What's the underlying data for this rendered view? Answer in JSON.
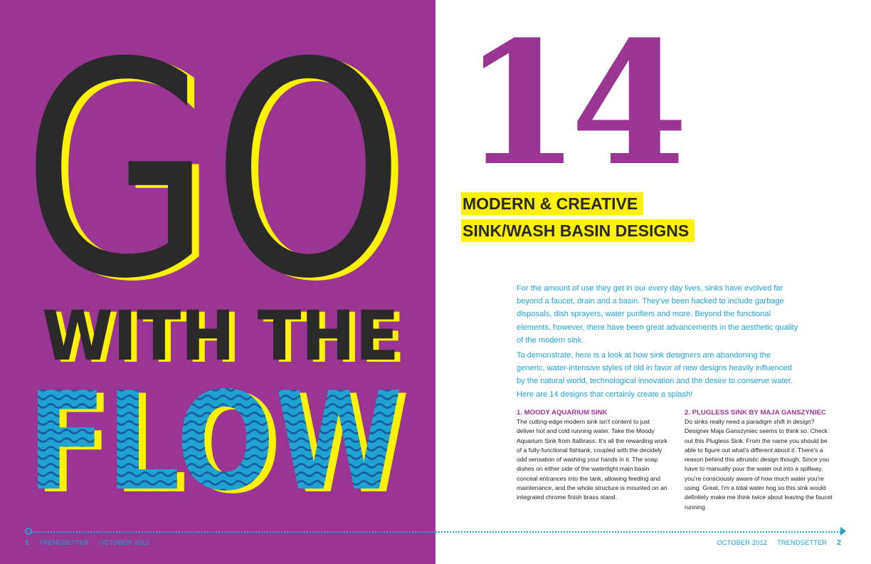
{
  "colors": {
    "purple": "#9b3593",
    "yellow": "#fff200",
    "blue": "#1fa3d0",
    "dark": "#2a2a2a"
  },
  "headline": {
    "line1": "GO",
    "line2": "WITH THE",
    "line3": "FLOW"
  },
  "article": {
    "number": "14",
    "title_line1": "MODERN & CREATIVE",
    "title_line2": "SINK/WASH BASIN DESIGNS",
    "intro_p1": "For the amount of use they get in our every day lives, sinks have evolved far beyond a faucet, drain and a basin. They've been hacked to include garbage disposals, dish sprayers, water purifiers and more. Beyond the functional elements, however, there have been great advancements in the aesthetic quality of the modern sink.",
    "intro_p2": "To demonstrate, here is a look at how sink designers are abandoning the generic, water-intensive styles of old in favor of new designs heavily influenced by the natural world, technological innovation and the desire to conserve water. Here are 14 designs that certainly create a splash!",
    "items": [
      {
        "heading": "1. MOODY AQUARIUM SINK",
        "body_before": "The cutting-edge modern sink isn't content to just deliver hot and cold running water. Take the Moody Aquarium Sink from ",
        "body_em": "Italbrass",
        "body_after": ". It's all the rewarding work of a fully-functional fishtank, coupled with the decidely odd sensation of washing your hands in it. The soap dishes on either side of the watertight main basin conceal entrances into the tank, allowing feeding and maintenance, and the whole structure is mounted on an integrated chrome finish brass stand."
      },
      {
        "heading": "2. PLUGLESS SINK BY MAJA GANSZYNIEC",
        "body": "Do sinks really need a paradigm shift in design? Designer Maja Ganszyniec seems to think so. Check out this Plugless Sink. From the name you should be able to figure out what's different about it. There's a reason behind this altruistic design though. Since you have to manually pour the water out into a spillway, you're consciously aware of how much water you're using. Great, I'm a total water hog so this sink would definitely make me think twice about leaving the faucet running."
      }
    ]
  },
  "footer": {
    "left": {
      "page": "1",
      "magazine": "TRENDSETTER",
      "issue": "OCTOBER 2012"
    },
    "right": {
      "issue": "OCTOBER 2012",
      "magazine": "TRENDSETTER",
      "page": "2"
    }
  }
}
